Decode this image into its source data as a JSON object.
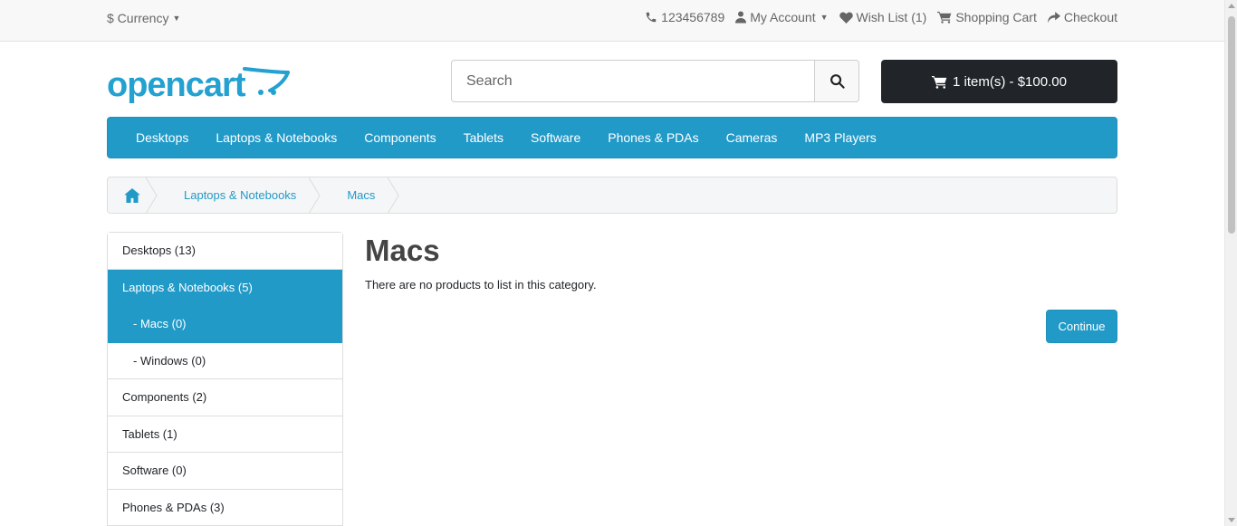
{
  "topbar": {
    "currency_label": "$ Currency",
    "phone": "123456789",
    "my_account": "My Account",
    "wish_list": "Wish List (1)",
    "shopping_cart": "Shopping Cart",
    "checkout": "Checkout"
  },
  "logo": {
    "text": "opencart",
    "brand_color": "#23a1d1"
  },
  "search": {
    "placeholder": "Search"
  },
  "cart": {
    "label": "1 item(s) - $100.00"
  },
  "menu": {
    "items": [
      "Desktops",
      "Laptops & Notebooks",
      "Components",
      "Tablets",
      "Software",
      "Phones & PDAs",
      "Cameras",
      "MP3 Players"
    ]
  },
  "breadcrumb": {
    "home_icon": "home-icon",
    "items": [
      "Laptops & Notebooks",
      "Macs"
    ]
  },
  "sidebar": {
    "items": [
      {
        "label": "Desktops (13)"
      },
      {
        "label": "Laptops & Notebooks (5)"
      },
      {
        "label": "- Macs (0)"
      },
      {
        "label": "- Windows (0)"
      },
      {
        "label": "Components (2)"
      },
      {
        "label": "Tablets (1)"
      },
      {
        "label": "Software (0)"
      },
      {
        "label": "Phones & PDAs (3)"
      }
    ]
  },
  "content": {
    "title": "Macs",
    "message": "There are no products to list in this category.",
    "continue_label": "Continue"
  },
  "colors": {
    "accent": "#229ac8",
    "dark_button": "#212529"
  }
}
